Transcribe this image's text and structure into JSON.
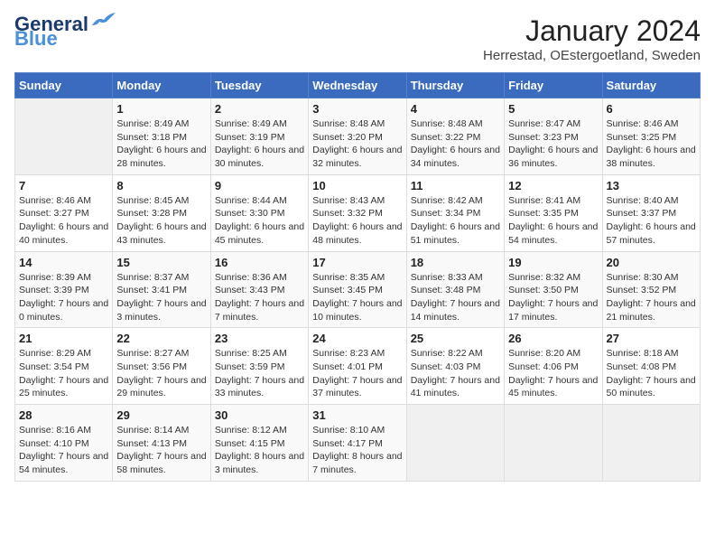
{
  "header": {
    "logo_general": "General",
    "logo_blue": "Blue",
    "title": "January 2024",
    "subtitle": "Herrestad, OEstergoetland, Sweden"
  },
  "calendar": {
    "days_of_week": [
      "Sunday",
      "Monday",
      "Tuesday",
      "Wednesday",
      "Thursday",
      "Friday",
      "Saturday"
    ],
    "weeks": [
      [
        {
          "day": "",
          "details": ""
        },
        {
          "day": "1",
          "details": "Sunrise: 8:49 AM\nSunset: 3:18 PM\nDaylight: 6 hours\nand 28 minutes."
        },
        {
          "day": "2",
          "details": "Sunrise: 8:49 AM\nSunset: 3:19 PM\nDaylight: 6 hours\nand 30 minutes."
        },
        {
          "day": "3",
          "details": "Sunrise: 8:48 AM\nSunset: 3:20 PM\nDaylight: 6 hours\nand 32 minutes."
        },
        {
          "day": "4",
          "details": "Sunrise: 8:48 AM\nSunset: 3:22 PM\nDaylight: 6 hours\nand 34 minutes."
        },
        {
          "day": "5",
          "details": "Sunrise: 8:47 AM\nSunset: 3:23 PM\nDaylight: 6 hours\nand 36 minutes."
        },
        {
          "day": "6",
          "details": "Sunrise: 8:46 AM\nSunset: 3:25 PM\nDaylight: 6 hours\nand 38 minutes."
        }
      ],
      [
        {
          "day": "7",
          "details": "Sunrise: 8:46 AM\nSunset: 3:27 PM\nDaylight: 6 hours\nand 40 minutes."
        },
        {
          "day": "8",
          "details": "Sunrise: 8:45 AM\nSunset: 3:28 PM\nDaylight: 6 hours\nand 43 minutes."
        },
        {
          "day": "9",
          "details": "Sunrise: 8:44 AM\nSunset: 3:30 PM\nDaylight: 6 hours\nand 45 minutes."
        },
        {
          "day": "10",
          "details": "Sunrise: 8:43 AM\nSunset: 3:32 PM\nDaylight: 6 hours\nand 48 minutes."
        },
        {
          "day": "11",
          "details": "Sunrise: 8:42 AM\nSunset: 3:34 PM\nDaylight: 6 hours\nand 51 minutes."
        },
        {
          "day": "12",
          "details": "Sunrise: 8:41 AM\nSunset: 3:35 PM\nDaylight: 6 hours\nand 54 minutes."
        },
        {
          "day": "13",
          "details": "Sunrise: 8:40 AM\nSunset: 3:37 PM\nDaylight: 6 hours\nand 57 minutes."
        }
      ],
      [
        {
          "day": "14",
          "details": "Sunrise: 8:39 AM\nSunset: 3:39 PM\nDaylight: 7 hours\nand 0 minutes."
        },
        {
          "day": "15",
          "details": "Sunrise: 8:37 AM\nSunset: 3:41 PM\nDaylight: 7 hours\nand 3 minutes."
        },
        {
          "day": "16",
          "details": "Sunrise: 8:36 AM\nSunset: 3:43 PM\nDaylight: 7 hours\nand 7 minutes."
        },
        {
          "day": "17",
          "details": "Sunrise: 8:35 AM\nSunset: 3:45 PM\nDaylight: 7 hours\nand 10 minutes."
        },
        {
          "day": "18",
          "details": "Sunrise: 8:33 AM\nSunset: 3:48 PM\nDaylight: 7 hours\nand 14 minutes."
        },
        {
          "day": "19",
          "details": "Sunrise: 8:32 AM\nSunset: 3:50 PM\nDaylight: 7 hours\nand 17 minutes."
        },
        {
          "day": "20",
          "details": "Sunrise: 8:30 AM\nSunset: 3:52 PM\nDaylight: 7 hours\nand 21 minutes."
        }
      ],
      [
        {
          "day": "21",
          "details": "Sunrise: 8:29 AM\nSunset: 3:54 PM\nDaylight: 7 hours\nand 25 minutes."
        },
        {
          "day": "22",
          "details": "Sunrise: 8:27 AM\nSunset: 3:56 PM\nDaylight: 7 hours\nand 29 minutes."
        },
        {
          "day": "23",
          "details": "Sunrise: 8:25 AM\nSunset: 3:59 PM\nDaylight: 7 hours\nand 33 minutes."
        },
        {
          "day": "24",
          "details": "Sunrise: 8:23 AM\nSunset: 4:01 PM\nDaylight: 7 hours\nand 37 minutes."
        },
        {
          "day": "25",
          "details": "Sunrise: 8:22 AM\nSunset: 4:03 PM\nDaylight: 7 hours\nand 41 minutes."
        },
        {
          "day": "26",
          "details": "Sunrise: 8:20 AM\nSunset: 4:06 PM\nDaylight: 7 hours\nand 45 minutes."
        },
        {
          "day": "27",
          "details": "Sunrise: 8:18 AM\nSunset: 4:08 PM\nDaylight: 7 hours\nand 50 minutes."
        }
      ],
      [
        {
          "day": "28",
          "details": "Sunrise: 8:16 AM\nSunset: 4:10 PM\nDaylight: 7 hours\nand 54 minutes."
        },
        {
          "day": "29",
          "details": "Sunrise: 8:14 AM\nSunset: 4:13 PM\nDaylight: 7 hours\nand 58 minutes."
        },
        {
          "day": "30",
          "details": "Sunrise: 8:12 AM\nSunset: 4:15 PM\nDaylight: 8 hours\nand 3 minutes."
        },
        {
          "day": "31",
          "details": "Sunrise: 8:10 AM\nSunset: 4:17 PM\nDaylight: 8 hours\nand 7 minutes."
        },
        {
          "day": "",
          "details": ""
        },
        {
          "day": "",
          "details": ""
        },
        {
          "day": "",
          "details": ""
        }
      ]
    ]
  }
}
